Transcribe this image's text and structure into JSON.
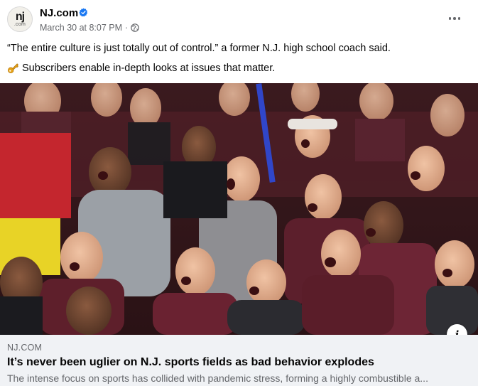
{
  "post": {
    "author": "NJ.com",
    "avatar_text": {
      "top": "nj",
      "bottom": ".com"
    },
    "timestamp": "March 30 at 8:07 PM",
    "separator": "·",
    "verified_icon": "verified-badge-icon",
    "privacy_icon": "globe-icon",
    "more_icon": "more-options-icon",
    "caption_line1": "“The entire culture is just totally out of control.” a former N.J. high school coach said.",
    "caption_line2": "Subscribers enable in-depth looks at issues that matter.",
    "caption_emoji": "key-icon"
  },
  "link": {
    "domain": "NJ.COM",
    "headline": "It’s never been uglier on N.J. sports fields as bad behavior explodes",
    "description": "The intense focus on sports has collided with pandemic stress, forming a highly combustible a...",
    "info_icon": "info-icon",
    "info_label": "i"
  },
  "colors": {
    "verified": "#1877f2",
    "secondary_text": "#65676b",
    "link_box_bg": "#f0f2f5",
    "maroon": "#6b2232"
  }
}
